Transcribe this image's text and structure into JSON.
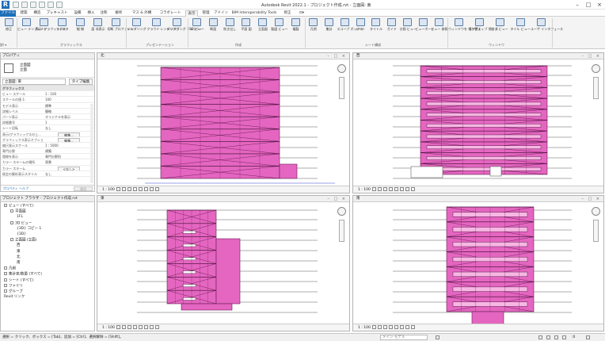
{
  "app": {
    "title": "Autodesk Revit 2022.1 - プロジェクト作成.rvt - 立面図: 東",
    "logo": "R"
  },
  "tabs": [
    "ファイル",
    "建築",
    "構造",
    "プレキャスト",
    "設備",
    "挿入",
    "注釈",
    "解析",
    "マス & 外構",
    "コラボレート",
    "表示",
    "管理",
    "アドイン",
    "BIM Interoperability Tools",
    "修正",
    "⊡▾"
  ],
  "ribbon": {
    "panels": [
      {
        "label": "選択 ▾",
        "buttons": [
          "修正"
        ]
      },
      {
        "label": "グラフィックス",
        "buttons": [
          "ビュー テンプレート",
          "表示/ グラフィックス",
          "フィルタ",
          "細 線",
          "面 非表示",
          "切断 プロファイル"
        ]
      },
      {
        "label": "プレゼンテーション",
        "buttons": [
          "レンダリング",
          "クラウド レンダリング",
          "レンダリング ギャラリー"
        ]
      },
      {
        "label": "作成",
        "buttons": [
          "3D ビュー",
          "断面",
          "吹き出し",
          "平面 図",
          "立面図",
          "製図 ビュー",
          "複製"
        ]
      },
      {
        "label": "シート構成",
        "buttons": [
          "凡例",
          "集計",
          "スコープ ボックス",
          "シート",
          "タイトル",
          "ガイド",
          "分割 ビュー",
          "ビューポート",
          "ビュー 参照"
        ]
      },
      {
        "label": "ウィンドウ",
        "buttons": [
          "ウィンドウを 切り替え",
          "非アクティブ 閉じる",
          "タブ ビュー",
          "タイル ビュー",
          "ユーザ インタフェース"
        ]
      }
    ]
  },
  "properties": {
    "header": "プロパティ",
    "type_name": "立面図",
    "type_sub": "立面",
    "filter": "立面図: 東",
    "edit_type": "タイプ編集",
    "rows": [
      {
        "k": "グラフィックス",
        "v": "",
        "cat": true
      },
      {
        "k": "ビュー スケール",
        "v": "1 : 100"
      },
      {
        "k": "スケールの値 1:",
        "v": "100"
      },
      {
        "k": "モデル表示",
        "v": "標準"
      },
      {
        "k": "詳細レベル",
        "v": "簡略"
      },
      {
        "k": "パーツ表示",
        "v": "オリジナルを表示"
      },
      {
        "k": "詳細番号",
        "v": "1"
      },
      {
        "k": "シート回転",
        "v": "なし"
      },
      {
        "k": "表示/グラフィックスの上...",
        "v": "",
        "btn": "編集..."
      },
      {
        "k": "グラフィックス表示オプション",
        "v": "",
        "btn": "編集..."
      },
      {
        "k": "縮尺表示スケール",
        "v": "1 : 5000"
      },
      {
        "k": "専門分野",
        "v": "建築"
      },
      {
        "k": "隠線を表示",
        "v": "専門分野別"
      },
      {
        "k": "カラー スキームの場所",
        "v": "背景"
      },
      {
        "k": "カラー スキーム",
        "v": "",
        "btn": "<なし>"
      },
      {
        "k": "既定の解析表示スタイル",
        "v": "なし"
      }
    ],
    "help": "プロパティ ヘルプ",
    "apply": "適用"
  },
  "browser": {
    "header": "プロジェクト ブラウザ - プロジェクト作成.rvt",
    "items": [
      {
        "label": "ビュー (すべて)",
        "indent": 0,
        "toggle": true
      },
      {
        "label": "平面図",
        "indent": 1,
        "toggle": true
      },
      {
        "label": "1FL",
        "indent": 2
      },
      {
        "label": "3D ビュー",
        "indent": 1,
        "toggle": true
      },
      {
        "label": "{3D} コピー 1",
        "indent": 2
      },
      {
        "label": "{3D}",
        "indent": 2
      },
      {
        "label": "立面図 (立面)",
        "indent": 1,
        "toggle": true
      },
      {
        "label": "西",
        "indent": 2
      },
      {
        "label": "東",
        "indent": 2
      },
      {
        "label": "北",
        "indent": 2
      },
      {
        "label": "南",
        "indent": 2
      },
      {
        "label": "凡例",
        "indent": 0,
        "toggle": true
      },
      {
        "label": "集計表/数量 (すべて)",
        "indent": 0,
        "toggle": true
      },
      {
        "label": "シート (すべて)",
        "indent": 0,
        "toggle": true
      },
      {
        "label": "ファミリ",
        "indent": 0,
        "toggle": true
      },
      {
        "label": "グループ",
        "indent": 0,
        "toggle": true
      },
      {
        "label": "Revit リンク",
        "indent": 0,
        "toggle": false
      }
    ]
  },
  "views": [
    {
      "name": "北",
      "scale": "1 : 100"
    },
    {
      "name": "西",
      "scale": "1 : 100"
    },
    {
      "name": "東",
      "scale": "1 : 100"
    },
    {
      "name": "南",
      "scale": "1 : 100"
    }
  ],
  "status": {
    "text": "選択 = クリック、ボックス = [Tab]、追加 = [Ctrl]、選択解除 = [Shift]。",
    "model_field": "メイン モデル",
    "filter_count": ":0"
  },
  "colors": {
    "facade": "#e466c0",
    "accent": "#1d6fb8"
  }
}
